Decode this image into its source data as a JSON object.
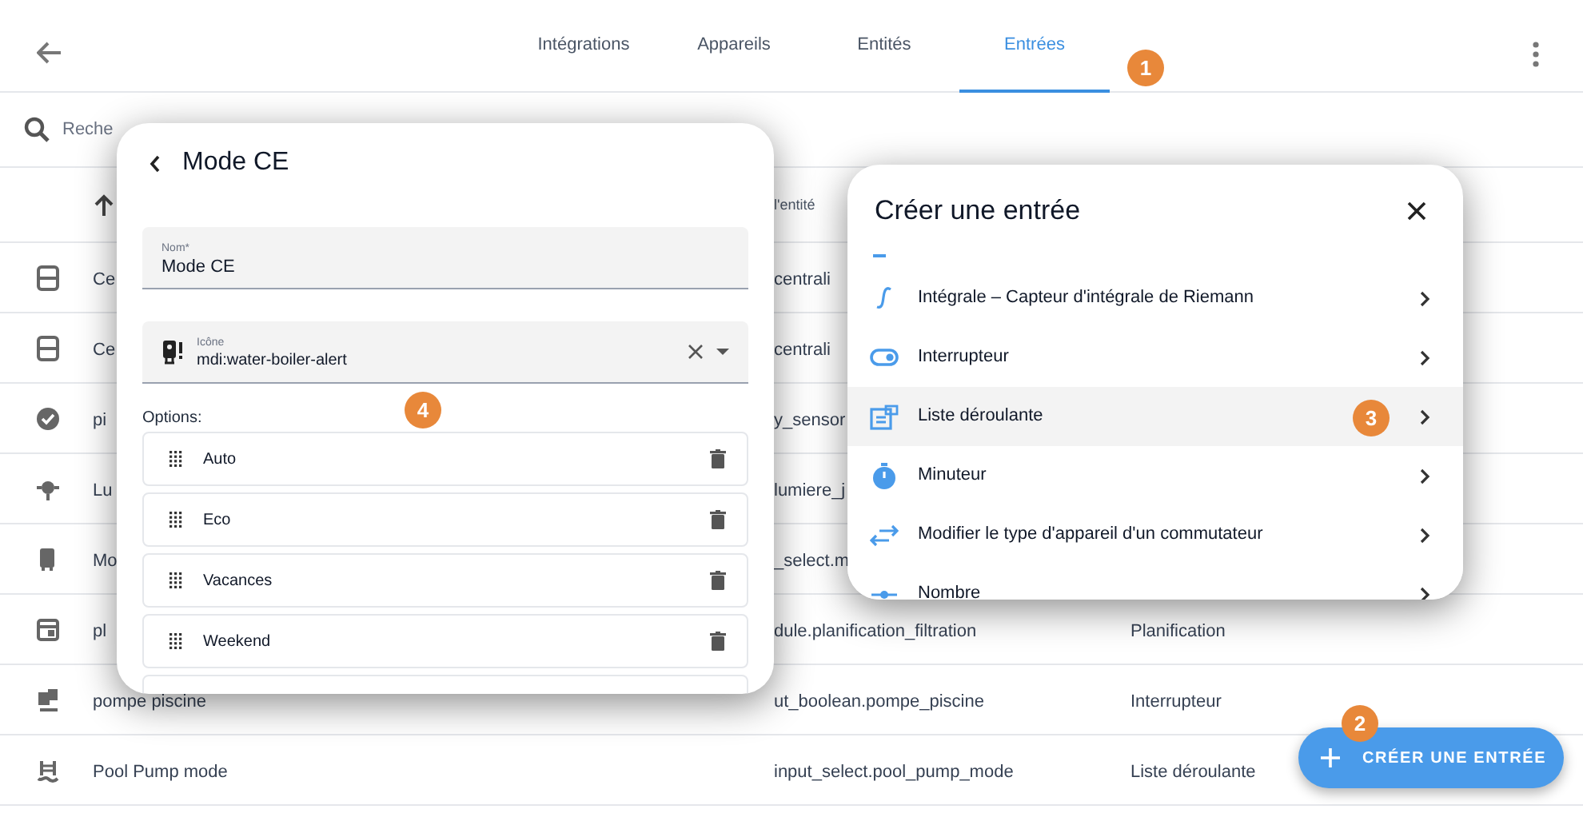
{
  "tabs": [
    {
      "label": "Intégrations",
      "selected": false
    },
    {
      "label": "Appareils",
      "selected": false
    },
    {
      "label": "Entités",
      "selected": false
    },
    {
      "label": "Entrées",
      "selected": true
    }
  ],
  "search": {
    "placeholder": "Reche"
  },
  "table": {
    "columns": [
      {
        "label": "l'entité"
      }
    ],
    "rows": [
      {
        "name": "Ce",
        "entity_id": "centrali"
      },
      {
        "name": "Ce",
        "entity_id": "centrali"
      },
      {
        "name": "pi",
        "entity_id": "y_sensor"
      },
      {
        "name": "Lu",
        "entity_id": "lumiere_j"
      },
      {
        "name": "Mo",
        "entity_id": "_select.m"
      },
      {
        "name": "pl",
        "entity_id": "dule.planification_filtration",
        "type": "Planification"
      },
      {
        "name": "pompe piscine",
        "entity_id": "ut_boolean.pompe_piscine",
        "type": "Interrupteur"
      },
      {
        "name": "Pool Pump mode",
        "entity_id": "input_select.pool_pump_mode",
        "type": "Liste déroulante"
      }
    ]
  },
  "edit_dialog": {
    "title": "Mode CE",
    "name_field": {
      "label": "Nom*",
      "value": "Mode CE"
    },
    "icon_field": {
      "label": "Icône",
      "value": "mdi:water-boiler-alert"
    },
    "options_label": "Options:",
    "options": [
      "Auto",
      "Eco",
      "Vacances",
      "Weekend"
    ]
  },
  "create_dialog": {
    "title": "Créer une entrée",
    "items": [
      {
        "kind": "integral",
        "label": "Intégrale – Capteur d'intégrale de Riemann",
        "selected": false
      },
      {
        "kind": "toggle",
        "label": "Interrupteur",
        "selected": false
      },
      {
        "kind": "select",
        "label": "Liste déroulante",
        "selected": true
      },
      {
        "kind": "timer",
        "label": "Minuteur",
        "selected": false
      },
      {
        "kind": "swap",
        "label": "Modifier le type d'appareil d'un commutateur",
        "selected": false
      },
      {
        "kind": "number",
        "label": "Nombre",
        "selected": false
      }
    ]
  },
  "fab": {
    "label": "CRÉER UNE ENTRÉE"
  },
  "callouts": [
    "1",
    "2",
    "3",
    "4"
  ]
}
